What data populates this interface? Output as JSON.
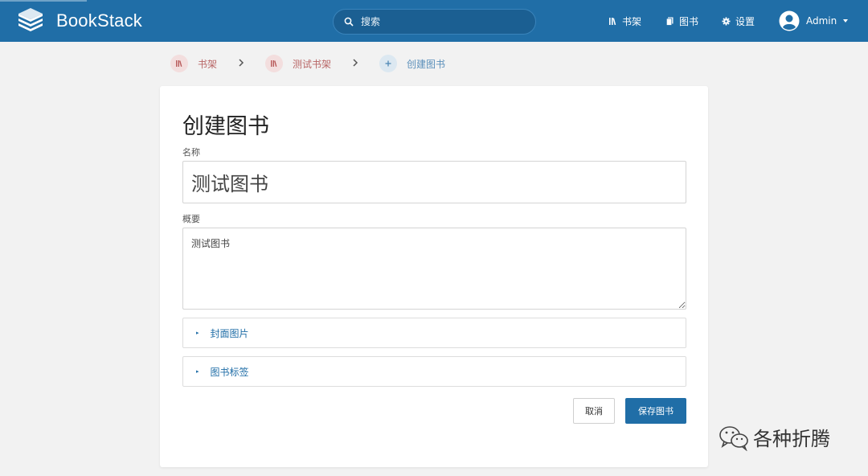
{
  "header": {
    "logo_text": "BookStack",
    "search_placeholder": "搜索",
    "nav": {
      "shelves": "书架",
      "books": "图书",
      "settings": "设置"
    },
    "user_name": "Admin"
  },
  "breadcrumbs": [
    {
      "label": "书架",
      "icon": "bookshelf-icon"
    },
    {
      "label": "测试书架",
      "icon": "bookshelf-icon"
    },
    {
      "label": "创建图书",
      "icon": "plus-icon"
    }
  ],
  "form": {
    "title": "创建图书",
    "name_label": "名称",
    "name_value": "测试图书",
    "description_label": "概要",
    "description_value": "测试图书",
    "cover_section": "封面图片",
    "tags_section": "图书标签",
    "cancel_label": "取消",
    "save_label": "保存图书"
  },
  "watermark": {
    "text": "各种折腾"
  },
  "colors": {
    "brand": "#206ea7",
    "shelf_accent": "#b86565"
  }
}
